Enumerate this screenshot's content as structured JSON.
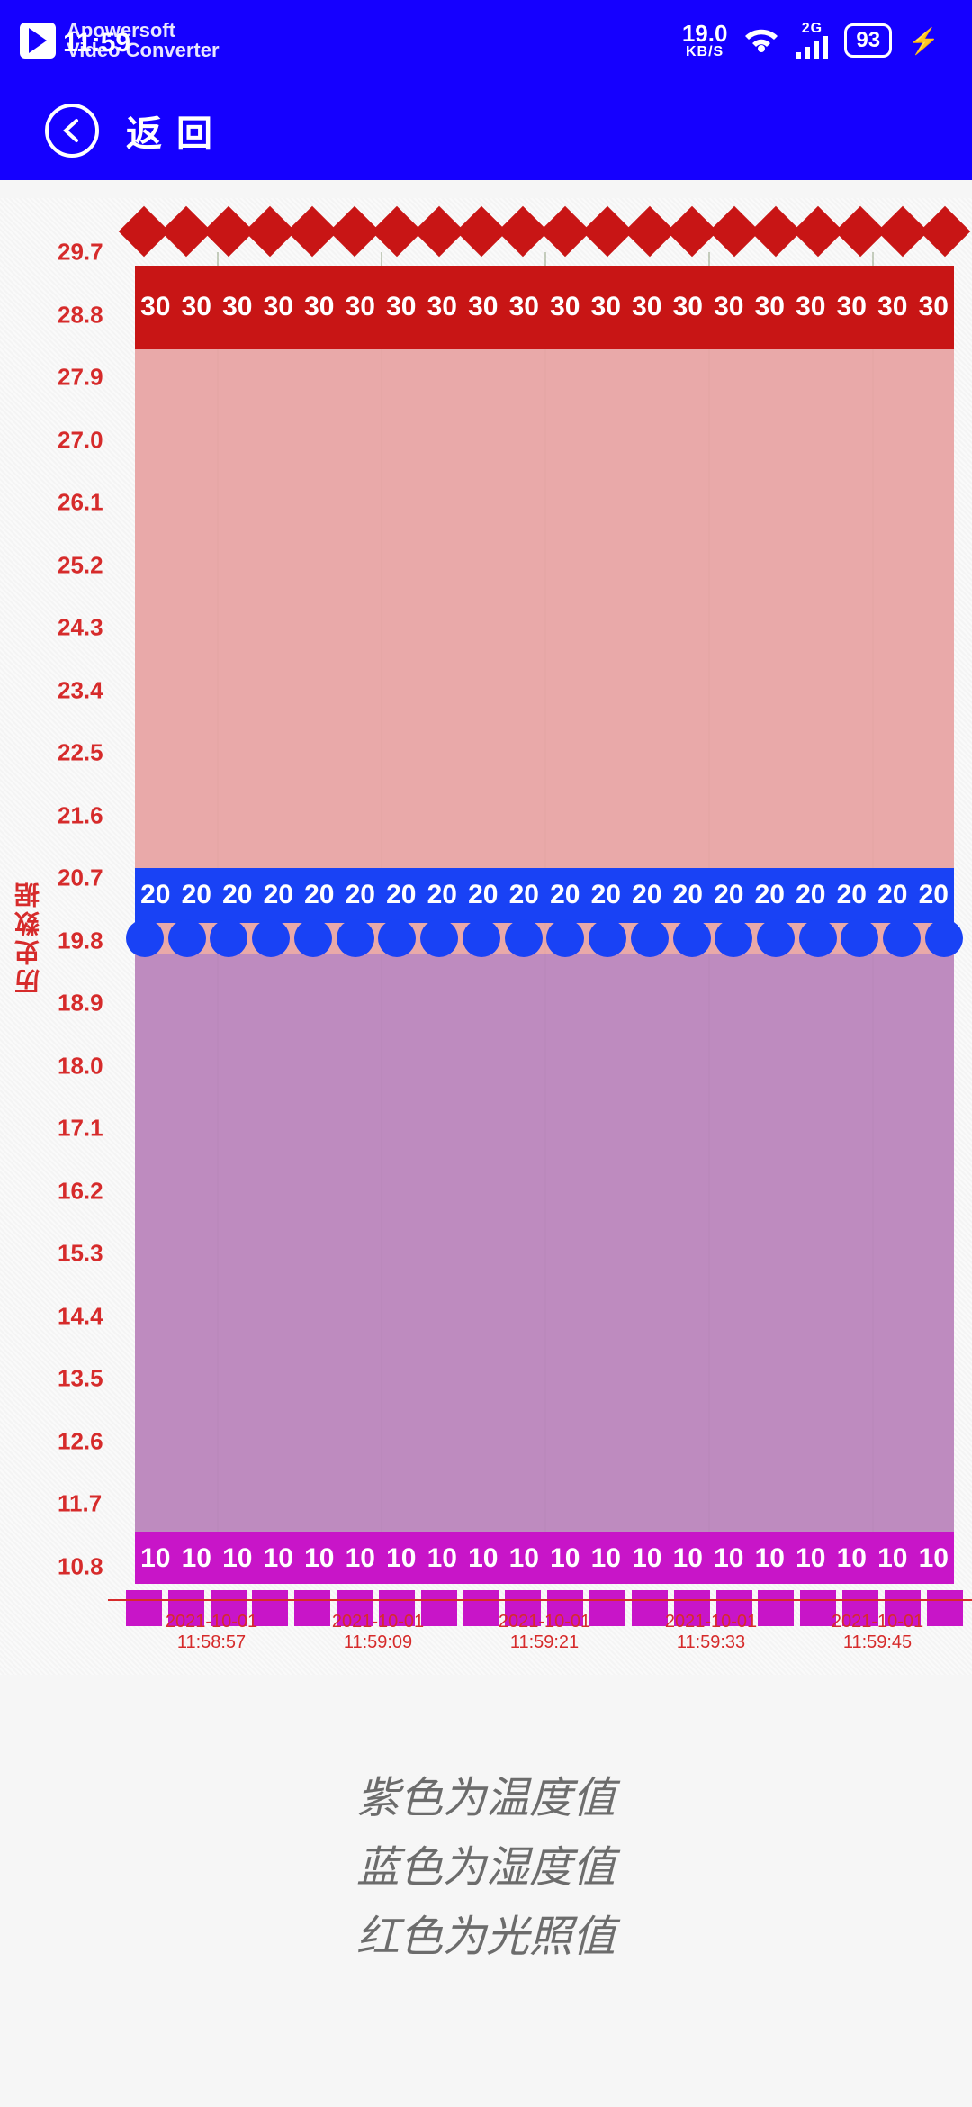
{
  "statusbar": {
    "time": "11:59",
    "watermark_top": "Apowersoft",
    "watermark_bottom": "Video Converter",
    "net_value": "19.0",
    "net_unit": "KB/S",
    "net_gen": "2G",
    "battery": "93"
  },
  "nav": {
    "back_label": "返回"
  },
  "chart": {
    "ylabel": "历史数据"
  },
  "legend": {
    "line1": "紫色为温度值",
    "line2": "蓝色为湿度值",
    "line3": "红色为光照值"
  },
  "chart_data": {
    "type": "line",
    "ylabel": "历史数据",
    "ylim": [
      10.8,
      29.7
    ],
    "y_ticks": [
      29.7,
      28.8,
      27.9,
      27.0,
      26.1,
      25.2,
      24.3,
      23.4,
      22.5,
      21.6,
      20.7,
      19.8,
      18.9,
      18.0,
      17.1,
      16.2,
      15.3,
      14.4,
      13.5,
      12.6,
      11.7,
      10.8
    ],
    "x_ticks": [
      "2021-10-01  11:58:57",
      "2021-10-01  11:59:09",
      "2021-10-01  11:59:21",
      "2021-10-01  11:59:33",
      "2021-10-01  11:59:45"
    ],
    "n_points": 20,
    "series": [
      {
        "name": "光照值",
        "color": "#c81515",
        "marker": "diamond",
        "value_label": "30",
        "values": [
          30,
          30,
          30,
          30,
          30,
          30,
          30,
          30,
          30,
          30,
          30,
          30,
          30,
          30,
          30,
          30,
          30,
          30,
          30,
          30
        ]
      },
      {
        "name": "湿度值",
        "color": "#1942f5",
        "marker": "circle",
        "value_label": "20",
        "values": [
          20,
          20,
          20,
          20,
          20,
          20,
          20,
          20,
          20,
          20,
          20,
          20,
          20,
          20,
          20,
          20,
          20,
          20,
          20,
          20
        ]
      },
      {
        "name": "温度值",
        "color": "#c815c8",
        "marker": "square",
        "value_label": "10",
        "values": [
          10,
          10,
          10,
          10,
          10,
          10,
          10,
          10,
          10,
          10,
          10,
          10,
          10,
          10,
          10,
          10,
          10,
          10,
          10,
          10
        ]
      }
    ]
  }
}
